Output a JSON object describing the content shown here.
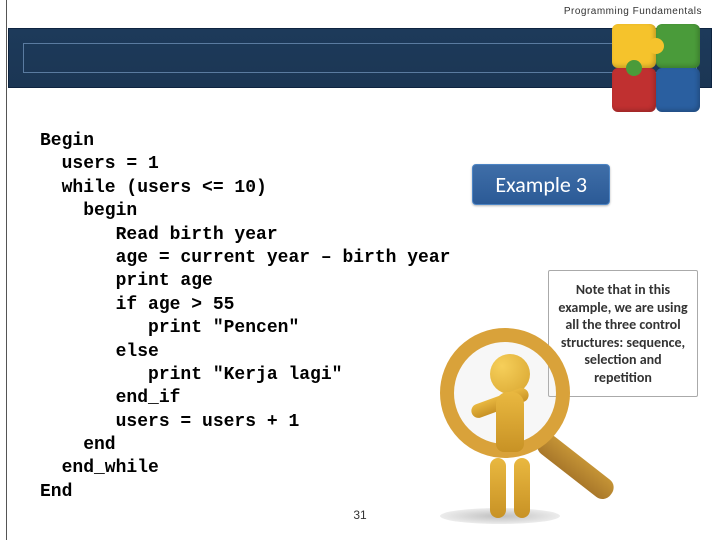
{
  "header": {
    "label": "Programming Fundamentals"
  },
  "badge": {
    "text": "Example 3"
  },
  "code": {
    "text": "Begin\n  users = 1\n  while (users <= 10)\n    begin\n       Read birth year\n       age = current year – birth year\n       print age\n       if age > 55\n          print \"Pencen\"\n       else\n          print \"Kerja lagi\"\n       end_if\n       users = users + 1\n    end\n  end_while\nEnd"
  },
  "note": {
    "text": "Note that in this example, we are using all the three control structures: sequence, selection and repetition"
  },
  "page": {
    "number": "31"
  }
}
